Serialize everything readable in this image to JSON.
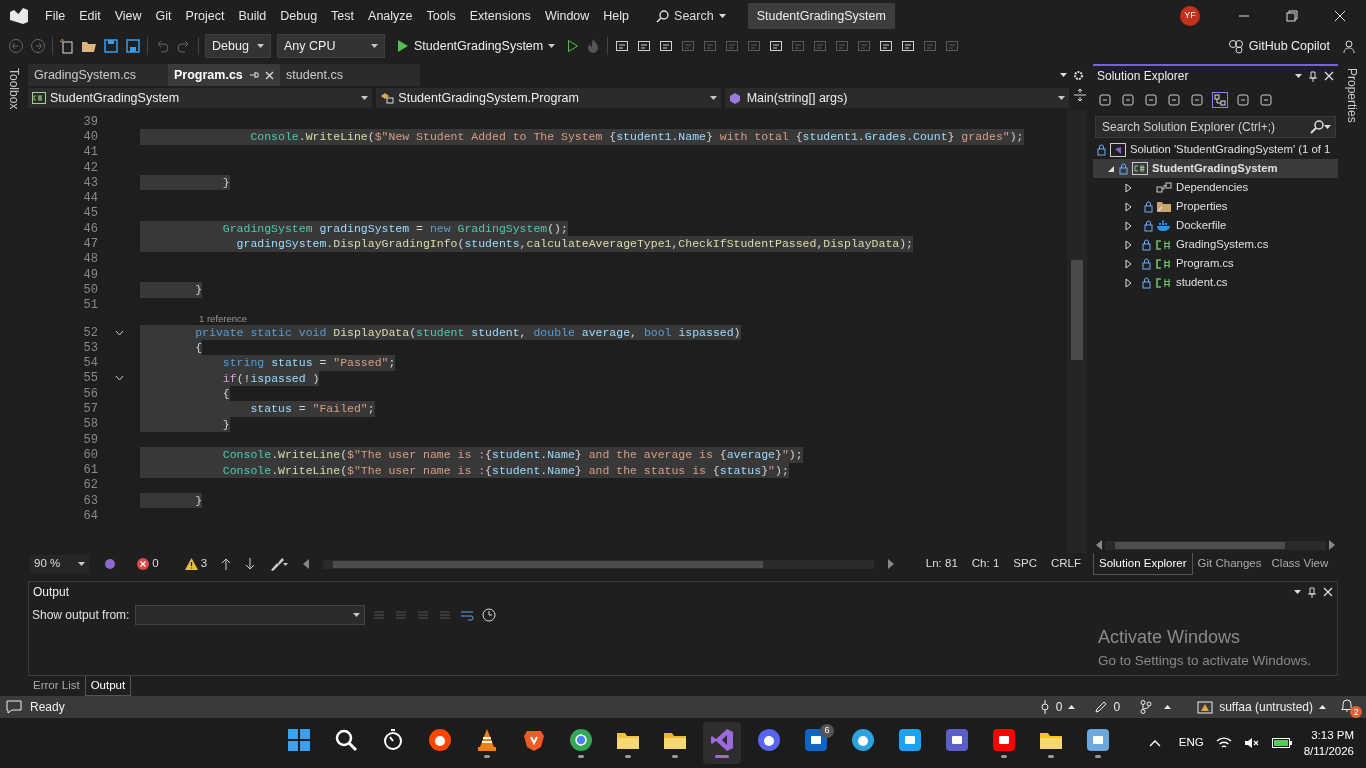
{
  "title_bar": {
    "menus": [
      "File",
      "Edit",
      "View",
      "Git",
      "Project",
      "Build",
      "Debug",
      "Test",
      "Analyze",
      "Tools",
      "Extensions",
      "Window",
      "Help"
    ],
    "search": "Search",
    "solution_title": "StudentGradingSystem",
    "avatar": "YF"
  },
  "toolbar": {
    "configuration": "Debug",
    "platform": "Any CPU",
    "startup_project": "StudentGradingSystem",
    "copilot": "GitHub Copilot"
  },
  "side_strips": {
    "left": "Toolbox",
    "right": "Properties"
  },
  "editor": {
    "tabs": [
      {
        "label": "GradingSystem.cs",
        "selected": false
      },
      {
        "label": "Program.cs",
        "selected": true
      },
      {
        "label": "student.cs",
        "selected": false
      }
    ],
    "nav": {
      "project": "StudentGradingSystem",
      "class": "StudentGradingSystem.Program",
      "member": "Main(string[] args)"
    },
    "lines": [
      {
        "number": "39"
      },
      {
        "number": "40",
        "highlighted": true,
        "tokens": [
          {
            "kind": "type",
            "text": "                Console"
          },
          {
            "kind": "plain",
            "text": "."
          },
          {
            "kind": "method",
            "text": "WriteLine"
          },
          {
            "kind": "plain",
            "text": "("
          },
          {
            "kind": "string",
            "text": "$\"New Student Added to The System "
          },
          {
            "kind": "plain",
            "text": "{"
          },
          {
            "kind": "var",
            "text": "student1"
          },
          {
            "kind": "plain",
            "text": "."
          },
          {
            "kind": "var",
            "text": "Name"
          },
          {
            "kind": "plain",
            "text": "}"
          },
          {
            "kind": "string",
            "text": " with total "
          },
          {
            "kind": "plain",
            "text": "{"
          },
          {
            "kind": "var",
            "text": "student1"
          },
          {
            "kind": "plain",
            "text": "."
          },
          {
            "kind": "var",
            "text": "Grades"
          },
          {
            "kind": "plain",
            "text": "."
          },
          {
            "kind": "var",
            "text": "Count"
          },
          {
            "kind": "plain",
            "text": "}"
          },
          {
            "kind": "string",
            "text": " grades\""
          },
          {
            "kind": "plain",
            "text": ");"
          }
        ]
      },
      {
        "number": "41"
      },
      {
        "number": "42"
      },
      {
        "number": "43",
        "highlighted": true,
        "tokens": [
          {
            "kind": "plain",
            "text": "            }"
          }
        ]
      },
      {
        "number": "44"
      },
      {
        "number": "45"
      },
      {
        "number": "46",
        "highlighted": true,
        "tokens": [
          {
            "kind": "type",
            "text": "            GradingSystem"
          },
          {
            "kind": "var",
            "text": " gradingSystem"
          },
          {
            "kind": "plain",
            "text": " = "
          },
          {
            "kind": "keyword",
            "text": "new"
          },
          {
            "kind": "type",
            "text": " GradingSystem"
          },
          {
            "kind": "plain",
            "text": "();"
          }
        ]
      },
      {
        "number": "47",
        "highlighted": true,
        "tokens": [
          {
            "kind": "var",
            "text": "              gradingSystem"
          },
          {
            "kind": "plain",
            "text": "."
          },
          {
            "kind": "method",
            "text": "DisplayGradingInfo"
          },
          {
            "kind": "plain",
            "text": "("
          },
          {
            "kind": "var",
            "text": "students"
          },
          {
            "kind": "plain",
            "text": ","
          },
          {
            "kind": "method",
            "text": "calculateAverageType1"
          },
          {
            "kind": "plain",
            "text": ","
          },
          {
            "kind": "method",
            "text": "CheckIfStudentPassed"
          },
          {
            "kind": "plain",
            "text": ","
          },
          {
            "kind": "method",
            "text": "DisplayData"
          },
          {
            "kind": "plain",
            "text": ");"
          }
        ]
      },
      {
        "number": "48"
      },
      {
        "number": "49"
      },
      {
        "number": "50",
        "highlighted": true,
        "tokens": [
          {
            "kind": "plain",
            "text": "        }"
          }
        ]
      },
      {
        "number": "51"
      },
      {
        "kind": "lens",
        "text": "1 reference"
      },
      {
        "number": "52",
        "highlighted": true,
        "foldable": true,
        "tokens": [
          {
            "kind": "keyword",
            "text": "        private static void"
          },
          {
            "kind": "method",
            "text": " DisplayData"
          },
          {
            "kind": "plain",
            "text": "("
          },
          {
            "kind": "type",
            "text": "student"
          },
          {
            "kind": "var",
            "text": " student"
          },
          {
            "kind": "plain",
            "text": ", "
          },
          {
            "kind": "keyword",
            "text": "double"
          },
          {
            "kind": "var",
            "text": " average"
          },
          {
            "kind": "plain",
            "text": ", "
          },
          {
            "kind": "keyword",
            "text": "bool"
          },
          {
            "kind": "var",
            "text": " ispassed"
          },
          {
            "kind": "plain",
            "text": ")"
          }
        ]
      },
      {
        "number": "53",
        "highlighted": true,
        "tokens": [
          {
            "kind": "plain",
            "text": "        {"
          }
        ]
      },
      {
        "number": "54",
        "highlighted": true,
        "tokens": [
          {
            "kind": "keyword",
            "text": "            string"
          },
          {
            "kind": "var",
            "text": " status"
          },
          {
            "kind": "plain",
            "text": " = "
          },
          {
            "kind": "string",
            "text": "\"Passed\""
          },
          {
            "kind": "plain",
            "text": ";"
          }
        ]
      },
      {
        "number": "55",
        "highlighted": true,
        "foldable": true,
        "tokens": [
          {
            "kind": "control",
            "text": "            if"
          },
          {
            "kind": "plain",
            "text": "(!"
          },
          {
            "kind": "var",
            "text": "ispassed"
          },
          {
            "kind": "plain",
            "text": " )"
          }
        ]
      },
      {
        "number": "56",
        "highlighted": true,
        "tokens": [
          {
            "kind": "plain",
            "text": "            {"
          }
        ]
      },
      {
        "number": "57",
        "highlighted": true,
        "tokens": [
          {
            "kind": "var",
            "text": "                status"
          },
          {
            "kind": "plain",
            "text": " = "
          },
          {
            "kind": "string",
            "text": "\"Failed\""
          },
          {
            "kind": "plain",
            "text": ";"
          }
        ]
      },
      {
        "number": "58",
        "highlighted": true,
        "tokens": [
          {
            "kind": "plain",
            "text": "            }"
          }
        ]
      },
      {
        "number": "59"
      },
      {
        "number": "60",
        "highlighted": true,
        "tokens": [
          {
            "kind": "type",
            "text": "            Console"
          },
          {
            "kind": "plain",
            "text": "."
          },
          {
            "kind": "method",
            "text": "WriteLine"
          },
          {
            "kind": "plain",
            "text": "("
          },
          {
            "kind": "string",
            "text": "$\"The user name is :"
          },
          {
            "kind": "plain",
            "text": "{"
          },
          {
            "kind": "var",
            "text": "student"
          },
          {
            "kind": "plain",
            "text": "."
          },
          {
            "kind": "var",
            "text": "Name"
          },
          {
            "kind": "plain",
            "text": "}"
          },
          {
            "kind": "string",
            "text": " and the average is "
          },
          {
            "kind": "plain",
            "text": "{"
          },
          {
            "kind": "var",
            "text": "average"
          },
          {
            "kind": "plain",
            "text": "}"
          },
          {
            "kind": "string",
            "text": "\""
          },
          {
            "kind": "plain",
            "text": ");"
          }
        ]
      },
      {
        "number": "61",
        "highlighted": true,
        "tokens": [
          {
            "kind": "type",
            "text": "            Console"
          },
          {
            "kind": "plain",
            "text": "."
          },
          {
            "kind": "method",
            "text": "WriteLine"
          },
          {
            "kind": "plain",
            "text": "("
          },
          {
            "kind": "string",
            "text": "$\"The user name is :"
          },
          {
            "kind": "plain",
            "text": "{"
          },
          {
            "kind": "var",
            "text": "student"
          },
          {
            "kind": "plain",
            "text": "."
          },
          {
            "kind": "var",
            "text": "Name"
          },
          {
            "kind": "plain",
            "text": "}"
          },
          {
            "kind": "string",
            "text": " and the status is "
          },
          {
            "kind": "plain",
            "text": "{"
          },
          {
            "kind": "var",
            "text": "status"
          },
          {
            "kind": "plain",
            "text": "}"
          },
          {
            "kind": "string",
            "text": "\""
          },
          {
            "kind": "plain",
            "text": ");"
          }
        ]
      },
      {
        "number": "62"
      },
      {
        "number": "63",
        "highlighted": true,
        "tokens": [
          {
            "kind": "plain",
            "text": "        }"
          }
        ]
      },
      {
        "number": "64"
      }
    ],
    "status": {
      "zoom": "90 %",
      "errors": "0",
      "warnings": "3",
      "line": "Ln: 81",
      "char": "Ch: 1",
      "whitespace": "SPC",
      "line_ending": "CRLF"
    }
  },
  "solution_explorer": {
    "title": "Solution Explorer",
    "search_placeholder": "Search Solution Explorer (Ctrl+;)",
    "solution": "Solution 'StudentGradingSystem' (1 of 1",
    "project": {
      "label": "StudentGradingSystem",
      "expanded": true,
      "children": [
        {
          "label": "Dependencies",
          "kind": "dependencies"
        },
        {
          "label": "Properties",
          "kind": "folder"
        },
        {
          "label": "Dockerfile",
          "kind": "docker"
        },
        {
          "label": "GradingSystem.cs",
          "kind": "csharp"
        },
        {
          "label": "Program.cs",
          "kind": "csharp"
        },
        {
          "label": "student.cs",
          "kind": "csharp"
        }
      ]
    },
    "tabs": [
      {
        "label": "Solution Explorer",
        "selected": true
      },
      {
        "label": "Git Changes",
        "selected": false
      },
      {
        "label": "Class View",
        "selected": false
      }
    ]
  },
  "output": {
    "title": "Output",
    "show_from": "Show output from:",
    "tabs": [
      {
        "label": "Error List",
        "selected": false
      },
      {
        "label": "Output",
        "selected": true
      }
    ]
  },
  "activation": {
    "title": "Activate Windows",
    "message": "Go to Settings to activate Windows."
  },
  "status_bar": {
    "state": "Ready",
    "pushes": "0",
    "edits": "0",
    "repo": "suffaa (untrusted)",
    "notifications": "2"
  },
  "taskbar": {
    "apps": [
      {
        "kind": "grid",
        "color": "#3aa0f0",
        "running": false
      },
      {
        "kind": "search",
        "color": "#ffffff",
        "running": false
      },
      {
        "kind": "stopwatch",
        "color": "#ffffff",
        "running": false
      },
      {
        "kind": "circle",
        "color": "#ff4500",
        "running": false
      },
      {
        "kind": "cone",
        "color": "#f08010",
        "running": true
      },
      {
        "kind": "shield",
        "color": "#f05a28",
        "running": false
      },
      {
        "kind": "ring",
        "color": "#34a853",
        "running": true
      },
      {
        "kind": "folder",
        "color": "#f0c040",
        "running": true
      },
      {
        "kind": "folder",
        "color": "#e8b830",
        "running": true
      },
      {
        "kind": "ribbon",
        "color": "#9b6bdb",
        "running": true,
        "active": true
      },
      {
        "kind": "circle",
        "color": "#5865f2",
        "running": false
      },
      {
        "kind": "square",
        "color": "#0a66c2",
        "running": false,
        "badge": "6"
      },
      {
        "kind": "circle",
        "color": "#2aa3e0",
        "running": false
      },
      {
        "kind": "square",
        "color": "#1da1f2",
        "running": false
      },
      {
        "kind": "square",
        "color": "#5b5fc7",
        "running": false
      },
      {
        "kind": "square",
        "color": "#ff0000",
        "running": true
      },
      {
        "kind": "folder",
        "color": "#f5c518",
        "running": true
      },
      {
        "kind": "square",
        "color": "#6fa8dc",
        "running": true
      }
    ],
    "language": "ENG",
    "time": "3:13 PM",
    "date": "8/11/2026"
  }
}
